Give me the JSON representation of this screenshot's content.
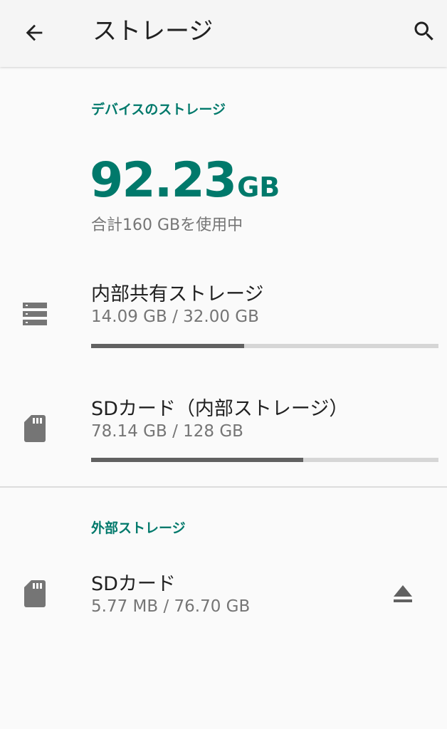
{
  "app_bar": {
    "title": "ストレージ",
    "back_icon": "arrow-back-icon",
    "search_icon": "search-icon"
  },
  "device_storage": {
    "header": "デバイスのストレージ",
    "total_used_value": "92.23",
    "total_used_unit": "GB",
    "total_caption": "合計160 GBを使用中"
  },
  "volumes": [
    {
      "icon": "storage-icon",
      "title": "内部共有ストレージ",
      "summary": "14.09 GB / 32.00 GB",
      "used_fraction": 0.44
    },
    {
      "icon": "sd-card-icon",
      "title": "SDカード（内部ストレージ）",
      "summary": "78.14 GB / 128 GB",
      "used_fraction": 0.61
    }
  ],
  "external_storage": {
    "header": "外部ストレージ",
    "items": [
      {
        "icon": "sd-card-icon",
        "title": "SDカード",
        "summary": "5.77 MB / 76.70 GB",
        "action_icon": "eject-icon"
      }
    ]
  },
  "colors": {
    "accent": "#00796b",
    "progress_fill": "#616161",
    "progress_track": "#d6d6d6"
  }
}
